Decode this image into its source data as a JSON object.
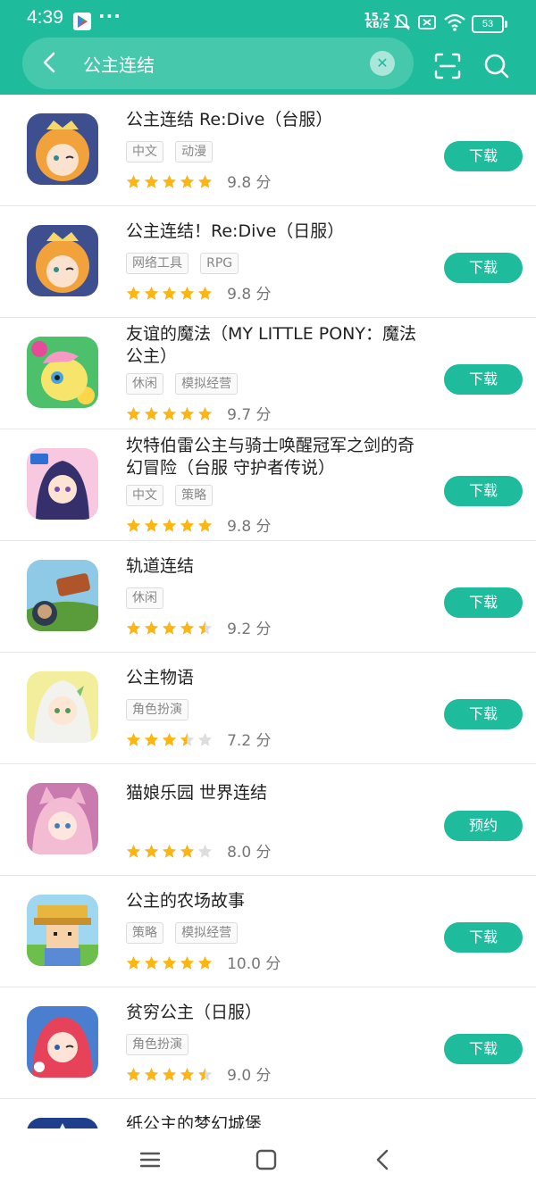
{
  "status_bar": {
    "time": "4:39",
    "dots": "···",
    "net_speed_value": "15.2",
    "net_speed_unit": "KB/s",
    "battery": "53"
  },
  "search": {
    "query": "公主连结"
  },
  "colors": {
    "accent": "#1ebc9c",
    "star_filled": "#fbb615",
    "star_empty": "#dddddd"
  },
  "apps": [
    {
      "title": "公主连结 Re:Dive（台服）",
      "tags": [
        "中文",
        "动漫"
      ],
      "rating": 5,
      "score": "9.8 分",
      "button": "下载",
      "icon": "anime-girl-icon"
    },
    {
      "title": "公主连结！Re:Dive（日服）",
      "tags": [
        "网络工具",
        "RPG"
      ],
      "rating": 5,
      "score": "9.8 分",
      "button": "下载",
      "icon": "anime-girl-icon"
    },
    {
      "title": "友谊的魔法（MY LITTLE PONY：魔法公主）",
      "tags": [
        "休闲",
        "模拟经营"
      ],
      "rating": 5,
      "score": "9.7 分",
      "button": "下载",
      "icon": "pony-icon"
    },
    {
      "title": "坎特伯雷公主与骑士唤醒冠军之剑的奇幻冒险（台服 守护者传说）",
      "tags": [
        "中文",
        "策略"
      ],
      "rating": 5,
      "score": "9.8 分",
      "button": "下载",
      "icon": "chibi-girl-icon"
    },
    {
      "title": "轨道连结",
      "tags": [
        "休闲"
      ],
      "rating": 4.5,
      "score": "9.2 分",
      "button": "下载",
      "icon": "train-icon"
    },
    {
      "title": "公主物语",
      "tags": [
        "角色扮演"
      ],
      "rating": 3.5,
      "score": "7.2 分",
      "button": "下载",
      "icon": "elf-girl-icon"
    },
    {
      "title": "猫娘乐园 世界连结",
      "tags": [],
      "rating": 4,
      "score": "8.0 分",
      "button": "预约",
      "icon": "cat-girl-icon"
    },
    {
      "title": "公主的农场故事",
      "tags": [
        "策略",
        "模拟经营"
      ],
      "rating": 5,
      "score": "10.0 分",
      "button": "下载",
      "icon": "pixel-farmer-icon"
    },
    {
      "title": "贫穷公主（日服）",
      "tags": [
        "角色扮演"
      ],
      "rating": 4.5,
      "score": "9.0 分",
      "button": "下载",
      "icon": "red-hair-girl-icon"
    },
    {
      "title": "纸公主的梦幻城堡",
      "tags": [],
      "rating": 0,
      "score": "",
      "button": "",
      "icon": "castle-icon"
    }
  ]
}
